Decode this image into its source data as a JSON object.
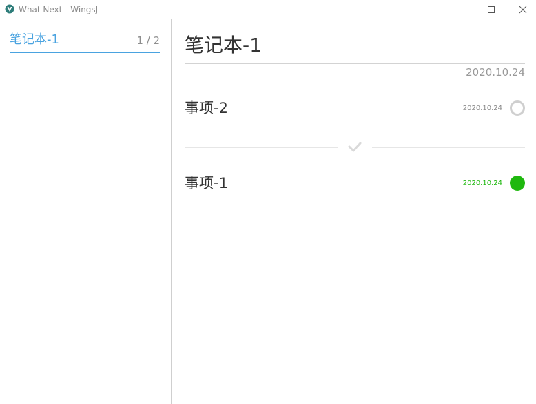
{
  "window": {
    "title": "What Next - WingsJ",
    "app_icon": "wings-logo-icon",
    "buttons": [
      "minimize-icon",
      "maximize-icon",
      "close-icon"
    ]
  },
  "sidebar": {
    "notebooks": [
      {
        "name": "笔记本-1",
        "count": "1 / 2"
      }
    ]
  },
  "main": {
    "title": "笔记本-1",
    "date": "2020.10.24",
    "pending_tasks": [
      {
        "title": "事项-2",
        "date": "2020.10.24",
        "status": "incomplete"
      }
    ],
    "separator_icon": "checkmark-icon",
    "completed_tasks": [
      {
        "title": "事项-1",
        "date": "2020.10.24",
        "status": "complete"
      }
    ]
  },
  "colors": {
    "accent": "#4aa3e0",
    "complete": "#1fb80f",
    "text": "#333333",
    "muted": "#999999",
    "ring": "#cfcfcf"
  }
}
